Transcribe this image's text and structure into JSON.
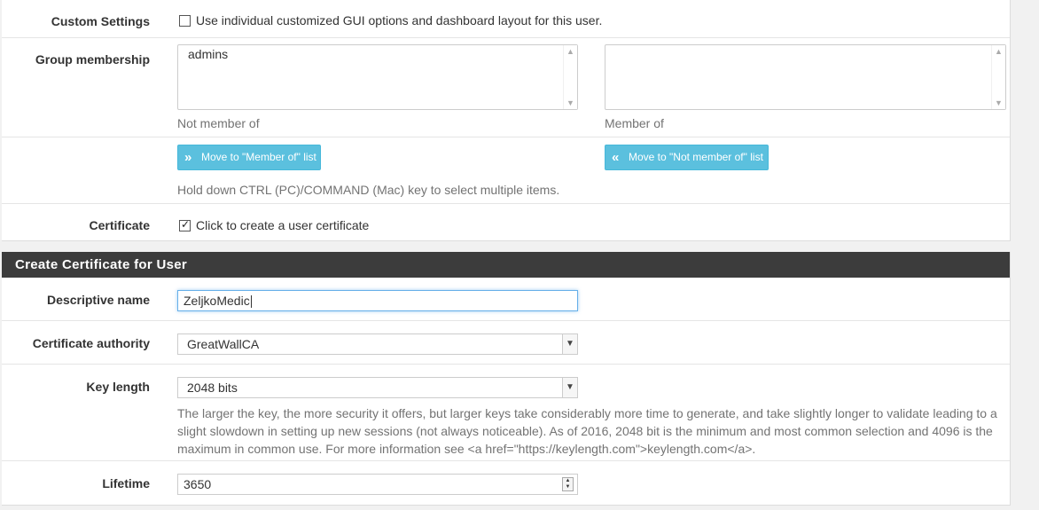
{
  "custom_settings": {
    "label": "Custom Settings",
    "checkbox_text": "Use individual customized GUI options and dashboard layout for this user.",
    "checked": false
  },
  "group_membership": {
    "label": "Group membership",
    "not_member_items": [
      "admins"
    ],
    "member_items": [],
    "not_member_caption": "Not member of",
    "member_caption": "Member of",
    "move_to_member_label": "Move to \"Member of\" list",
    "move_to_not_member_label": "Move to \"Not member of\" list",
    "hint": "Hold down CTRL (PC)/COMMAND (Mac) key to select multiple items."
  },
  "certificate": {
    "label": "Certificate",
    "checkbox_text": "Click to create a user certificate",
    "checked": true
  },
  "create_cert_section": {
    "title": "Create Certificate for User",
    "descriptive_name": {
      "label": "Descriptive name",
      "value": "ZeljkoMedic"
    },
    "certificate_authority": {
      "label": "Certificate authority",
      "value": "GreatWallCA"
    },
    "key_length": {
      "label": "Key length",
      "value": "2048 bits",
      "help": "The larger the key, the more security it offers, but larger keys take considerably more time to generate, and take slightly longer to validate leading to a slight slowdown in setting up new sessions (not always noticeable). As of 2016, 2048 bit is the minimum and most common selection and 4096 is the maximum in common use. For more information see <a href=\"https://keylength.com\">keylength.com</a>."
    },
    "lifetime": {
      "label": "Lifetime",
      "value": "3650"
    }
  },
  "colors": {
    "info_button": "#5bc0de",
    "section_header_bg": "#3c3c3c",
    "focus_border": "#66afe9"
  }
}
